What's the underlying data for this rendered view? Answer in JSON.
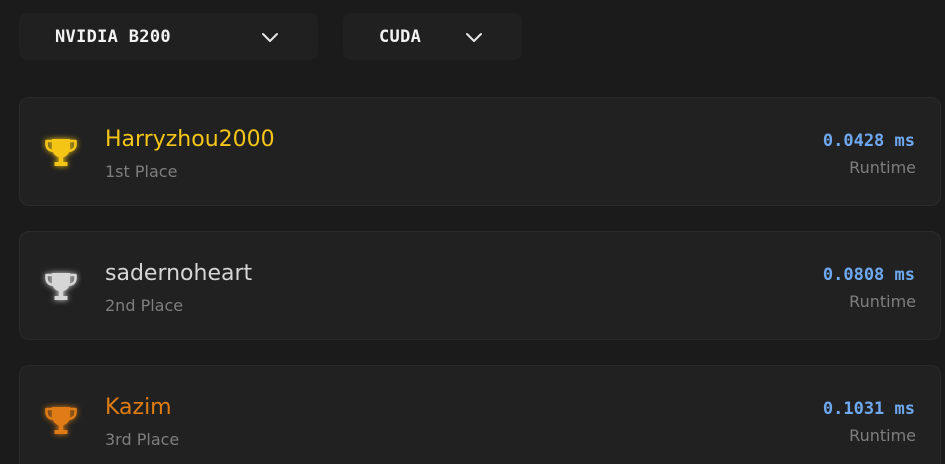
{
  "filters": {
    "gpu": {
      "label": "NVIDIA B200",
      "icon": "chevron-down-icon"
    },
    "language": {
      "label": "CUDA",
      "icon": "chevron-down-icon"
    }
  },
  "leaderboard": [
    {
      "rank_label": "1st Place",
      "user": "Harryzhou2000",
      "runtime": "0.0428 ms",
      "runtime_label": "Runtime",
      "color": "#f5c518",
      "icon": "trophy-gold-icon"
    },
    {
      "rank_label": "2nd Place",
      "user": "sadernoheart",
      "runtime": "0.0808 ms",
      "runtime_label": "Runtime",
      "color": "#d6d6d6",
      "icon": "trophy-silver-icon"
    },
    {
      "rank_label": "3rd Place",
      "user": "Kazim",
      "runtime": "0.1031 ms",
      "runtime_label": "Runtime",
      "color": "#e07c12",
      "icon": "trophy-bronze-icon"
    }
  ],
  "colors": {
    "background": "#1b1b1b",
    "card": "#212121",
    "runtime_text": "#6ea8f0",
    "muted_text": "#7e7e7e"
  }
}
